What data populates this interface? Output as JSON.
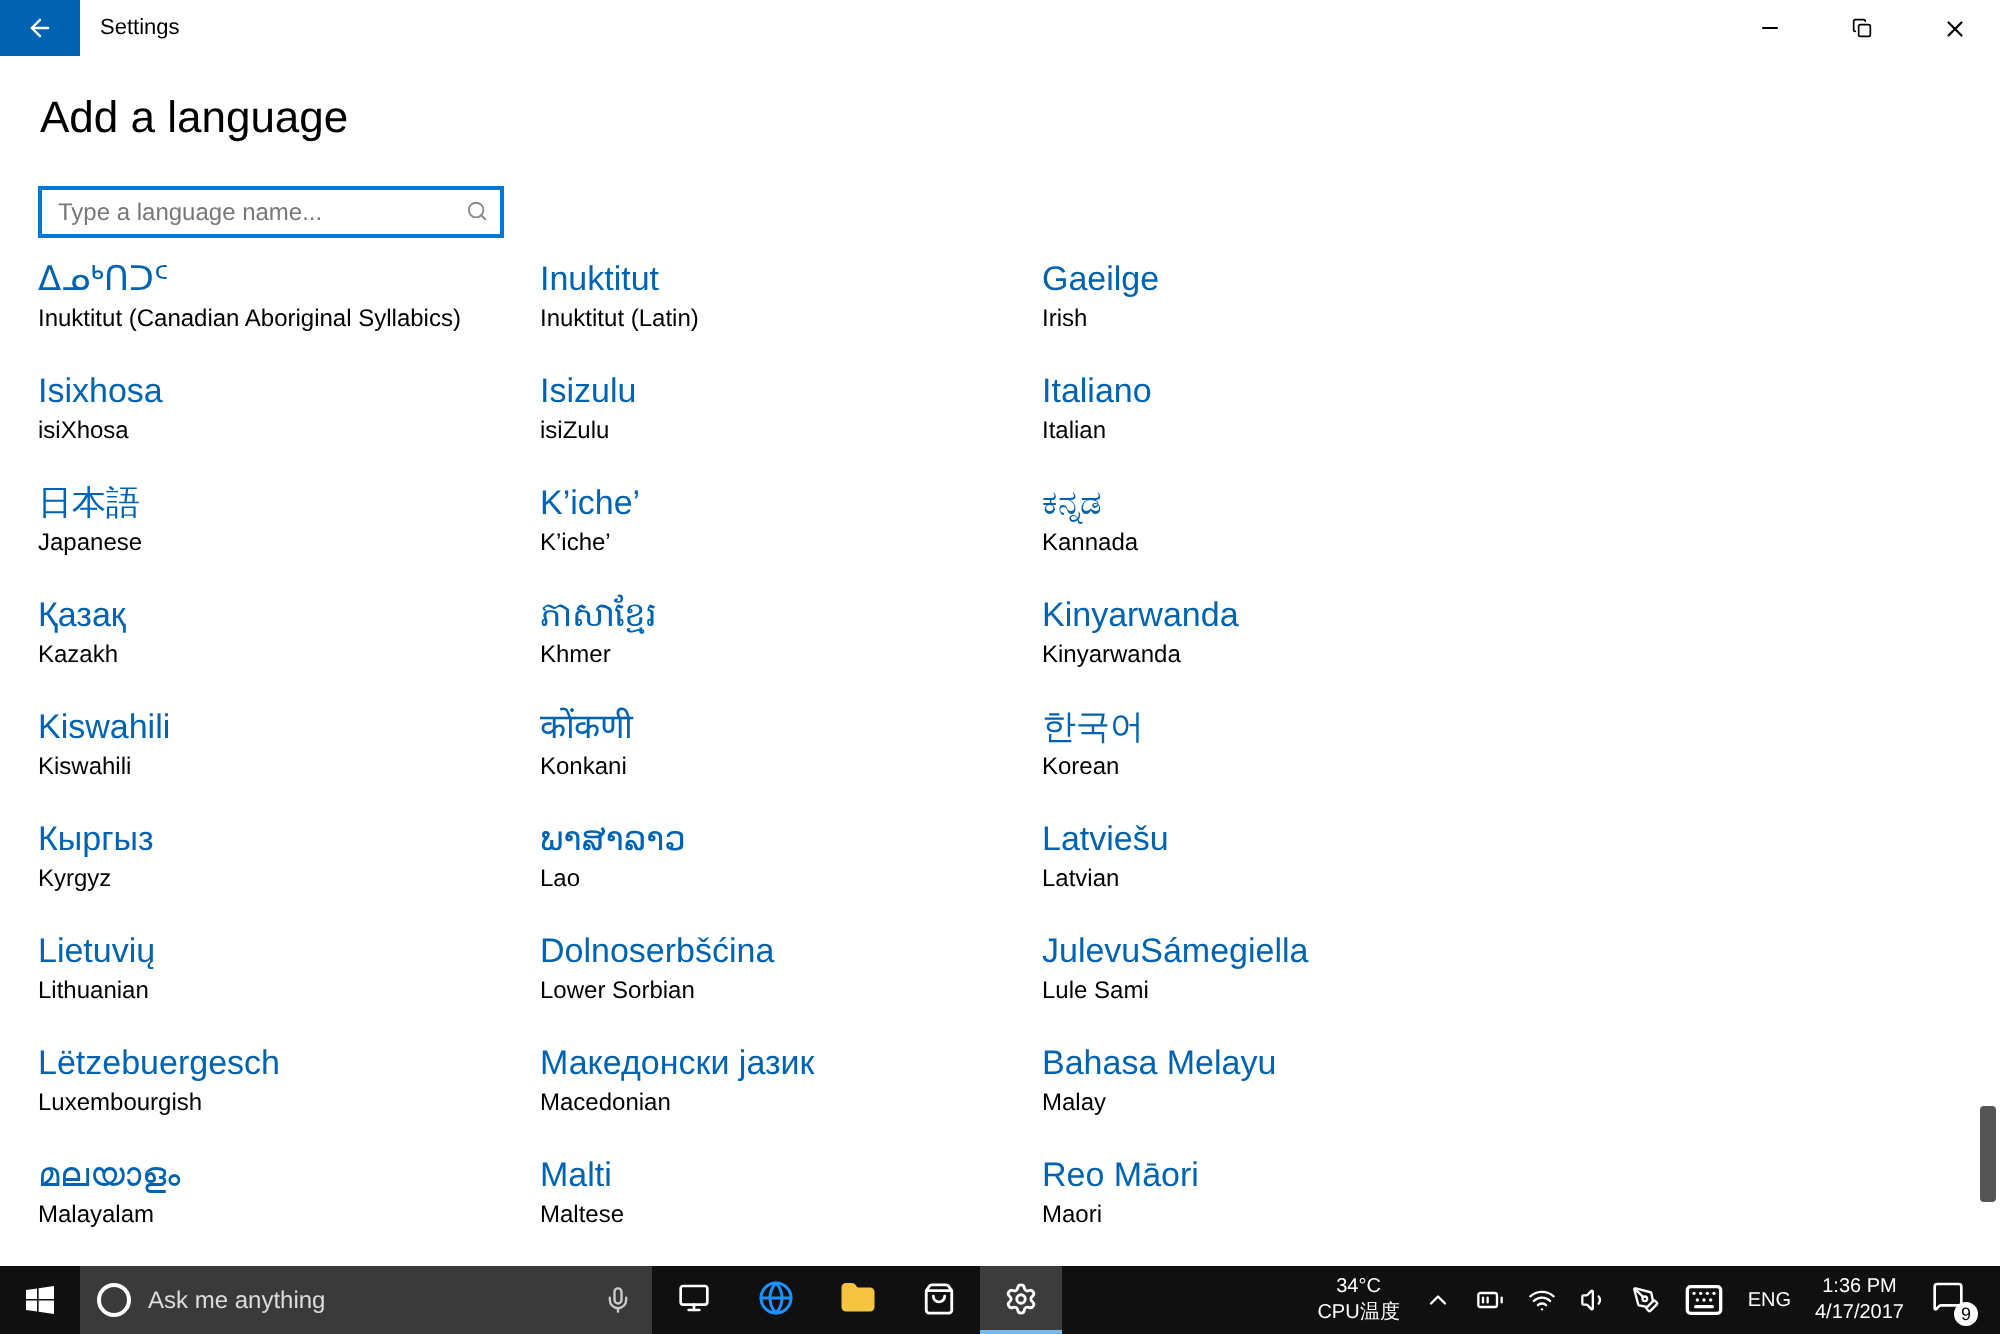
{
  "window": {
    "title": "Settings"
  },
  "page": {
    "heading": "Add a language",
    "search": {
      "placeholder": "Type a language name..."
    }
  },
  "languages": [
    {
      "native": "ᐃᓄᒃᑎᑐᑦ",
      "english": "Inuktitut (Canadian Aboriginal Syllabics)"
    },
    {
      "native": "Inuktitut",
      "english": "Inuktitut (Latin)"
    },
    {
      "native": "Gaeilge",
      "english": "Irish"
    },
    {
      "native": "Isixhosa",
      "english": "isiXhosa"
    },
    {
      "native": "Isizulu",
      "english": "isiZulu"
    },
    {
      "native": "Italiano",
      "english": "Italian"
    },
    {
      "native": "日本語",
      "english": "Japanese"
    },
    {
      "native": "K’iche’",
      "english": "K’iche’"
    },
    {
      "native": "ಕನ್ನಡ",
      "english": "Kannada"
    },
    {
      "native": "Қазақ",
      "english": "Kazakh"
    },
    {
      "native": "ភាសាខ្មែរ",
      "english": "Khmer"
    },
    {
      "native": "Kinyarwanda",
      "english": "Kinyarwanda"
    },
    {
      "native": "Kiswahili",
      "english": "Kiswahili"
    },
    {
      "native": "कोंकणी",
      "english": "Konkani"
    },
    {
      "native": "한국어",
      "english": "Korean"
    },
    {
      "native": "Кыргыз",
      "english": "Kyrgyz"
    },
    {
      "native": "ພາສາລາວ",
      "english": "Lao"
    },
    {
      "native": "Latviešu",
      "english": "Latvian"
    },
    {
      "native": "Lietuvių",
      "english": "Lithuanian"
    },
    {
      "native": "Dolnoserbšćina",
      "english": "Lower Sorbian"
    },
    {
      "native": "JulevuSámegiella",
      "english": "Lule Sami"
    },
    {
      "native": "Lëtzebuergesch",
      "english": "Luxembourgish"
    },
    {
      "native": "Македонски јазик",
      "english": "Macedonian"
    },
    {
      "native": "Bahasa Melayu",
      "english": "Malay"
    },
    {
      "native": "മലയാളം",
      "english": "Malayalam"
    },
    {
      "native": "Malti",
      "english": "Maltese"
    },
    {
      "native": "Reo Māori",
      "english": "Maori"
    }
  ],
  "taskbar": {
    "search_placeholder": "Ask me anything",
    "apps": [
      {
        "kind": "taskview",
        "selected": false
      },
      {
        "kind": "browser",
        "selected": false
      },
      {
        "kind": "folder",
        "selected": false
      },
      {
        "kind": "store",
        "selected": false
      },
      {
        "kind": "settings",
        "selected": true
      }
    ],
    "temperature": "34°C",
    "temperature_label": "CPU温度",
    "input_language": "ENG",
    "time": "1:36 PM",
    "date": "4/17/2017",
    "notification_count": "9"
  }
}
